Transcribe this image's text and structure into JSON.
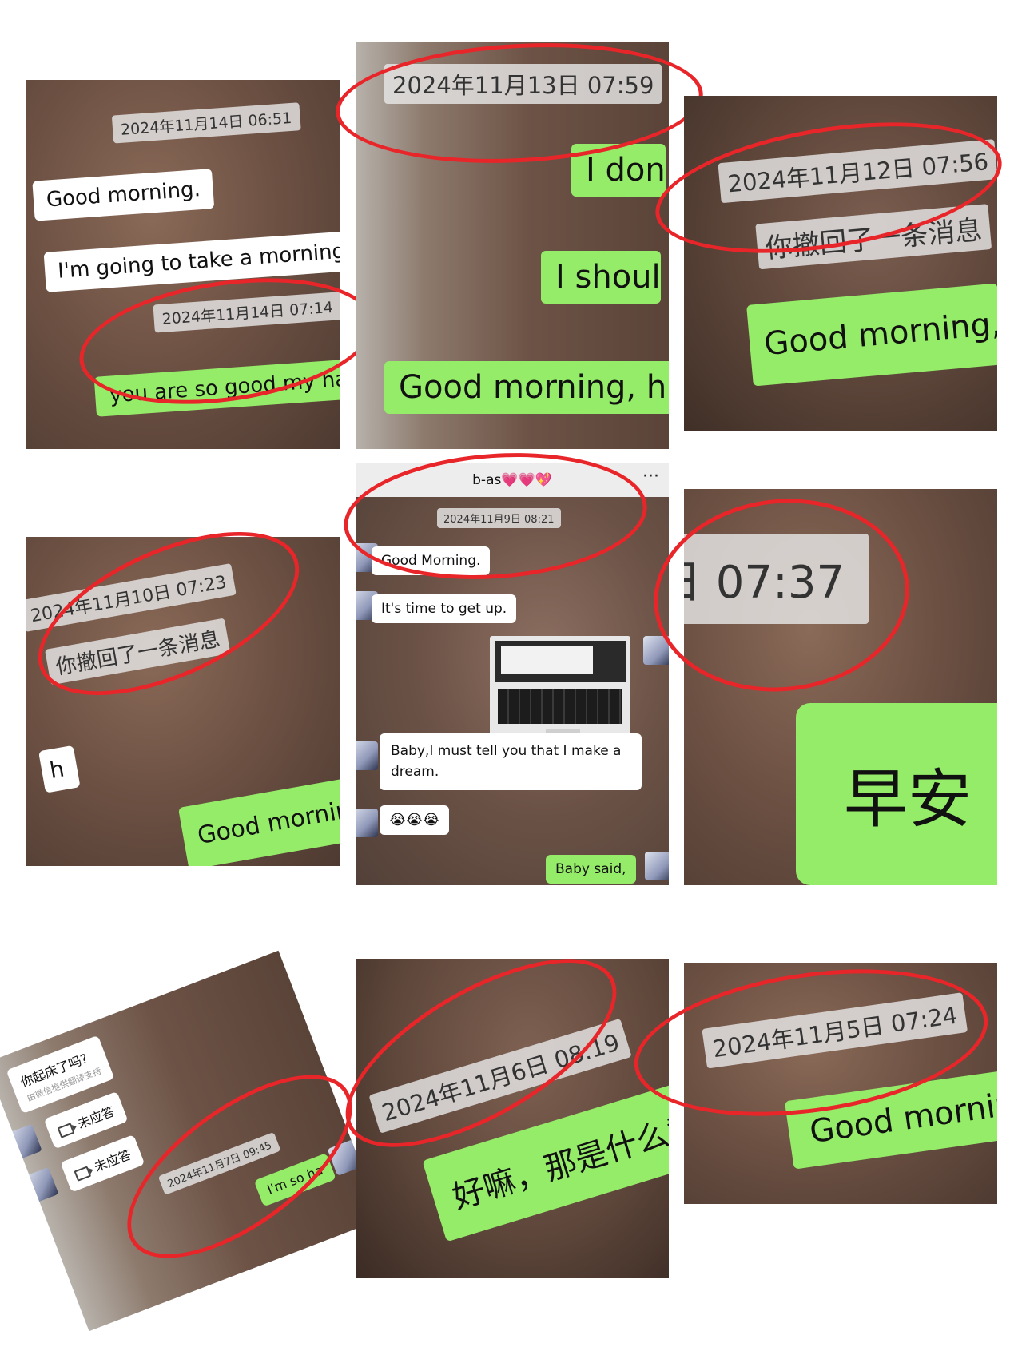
{
  "colors": {
    "annotation_red": "#e8262a",
    "sent_bubble": "#95ec69",
    "received_bubble": "#ffffff"
  },
  "panels": {
    "p1": {
      "time_1": "2024年11月14日 06:51",
      "msg_1": "Good morning.",
      "msg_2": "I'm going to take a morning r",
      "time_2": "2024年11月14日 07:14",
      "msg_3": "you are so good.my hans"
    },
    "p2": {
      "time": "2024年11月13日 07:59",
      "msg_1": "I don",
      "msg_2": "I shoul",
      "msg_3": "Good morning, hu"
    },
    "p3": {
      "time": "2024年11月12日 07:56",
      "recall": "你撤回了一条消息",
      "msg": "Good morning,"
    },
    "p4": {
      "time": "2024年11月10日 07:23",
      "recall": "你撤回了一条消息",
      "msg_left": "h",
      "msg": "Good morning"
    },
    "p5": {
      "contact": "b-as💗💗💖",
      "menu": "···",
      "time": "2024年11月9日 08:21",
      "msg_1": "Good Morning.",
      "msg_2": "It's time to get up.",
      "msg_3": "Baby,I must tell you that I make a dream.",
      "msg_4": "😭😭😭",
      "msg_5": "Baby said,"
    },
    "p6": {
      "time": "日 07:37",
      "msg": "早安"
    },
    "p7": {
      "msg_1": "你起床了吗?",
      "msg_1_note": "由微信提供翻译支持",
      "call_1": "未应答",
      "call_2": "未应答",
      "time": "2024年11月7日 09:45",
      "msg_2": "I'm so ha"
    },
    "p8": {
      "time": "2024年11月6日 08:19",
      "msg": "好嘛，那是什么意思"
    },
    "p9": {
      "time": "2024年11月5日 07:24",
      "msg": "Good morning,"
    }
  }
}
